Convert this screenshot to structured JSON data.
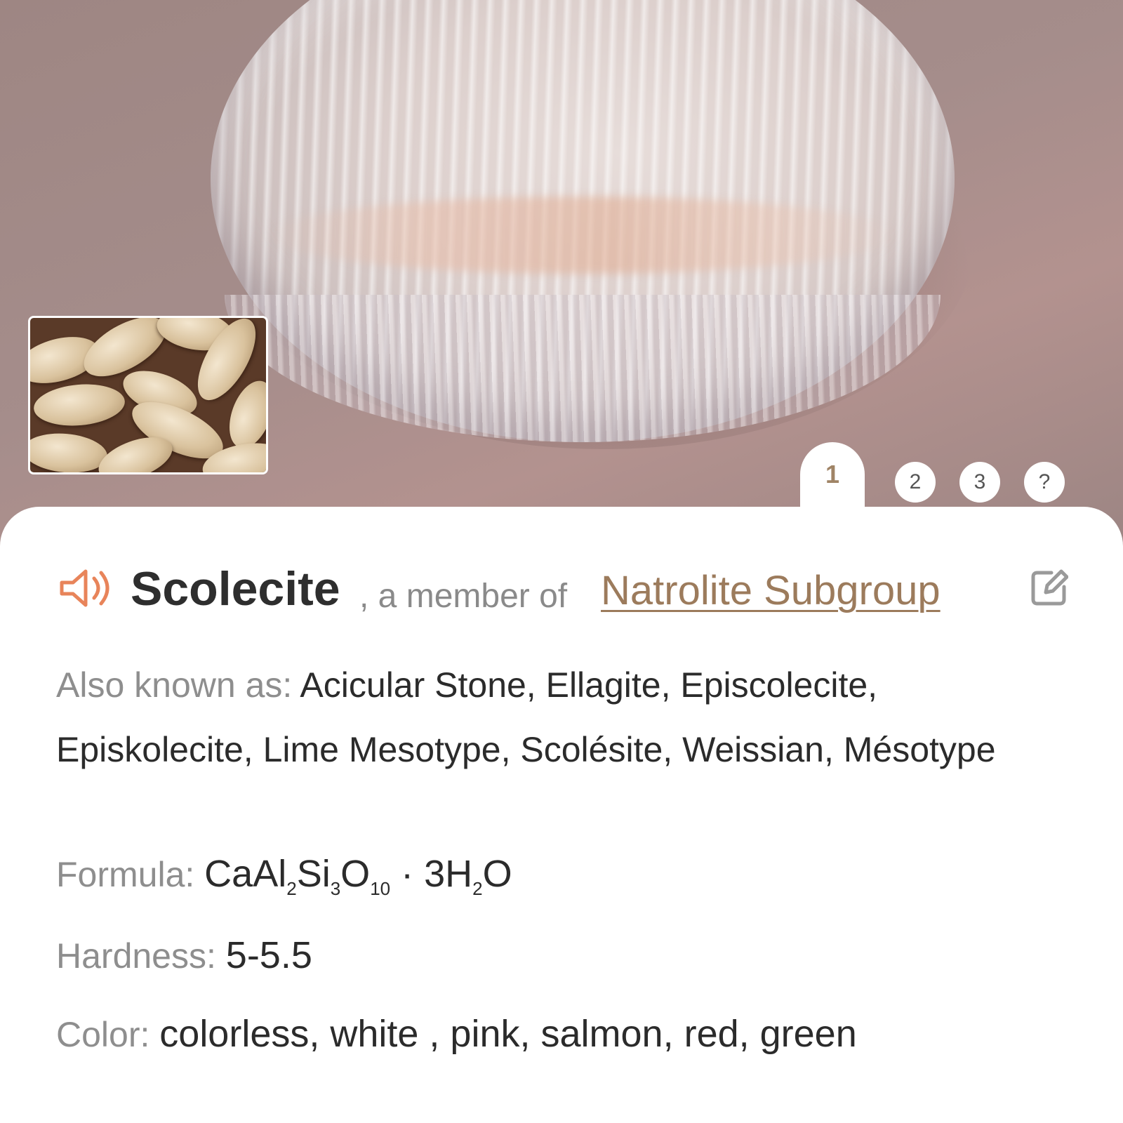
{
  "hero": {
    "main_image": "scolecite-polished-stone-photo",
    "thumbnail": "scolecite-tumbled-pebbles-photo",
    "pager": [
      "1",
      "2",
      "3",
      "?"
    ],
    "active_page": "1"
  },
  "header": {
    "speaker_icon": "speaker-icon",
    "name": "Scolecite",
    "member_text": ", a member of",
    "group_link": "Natrolite Subgroup",
    "edit_icon": "edit-icon"
  },
  "details": {
    "aka_label": "Also known as:",
    "aka_value": "Acicular Stone, Ellagite, Episcolecite, Episkolecite, Lime Mesotype, Scolésite, Weissian, Mésotype",
    "formula_label": "Formula:",
    "formula_parts": {
      "p1": "CaAl",
      "s1": "2",
      "p2": "Si",
      "s2": "3",
      "p3": "O",
      "s3": "10",
      "p4": " · 3H",
      "s4": "2",
      "p5": "O"
    },
    "hardness_label": "Hardness:",
    "hardness_value": "5-5.5",
    "color_label": "Color:",
    "color_value": "colorless, white , pink, salmon, red, green"
  },
  "colors": {
    "accent": "#9c7b5c",
    "speaker": "#e8845a",
    "label": "#8e8e8e",
    "text": "#2b2b2b"
  }
}
